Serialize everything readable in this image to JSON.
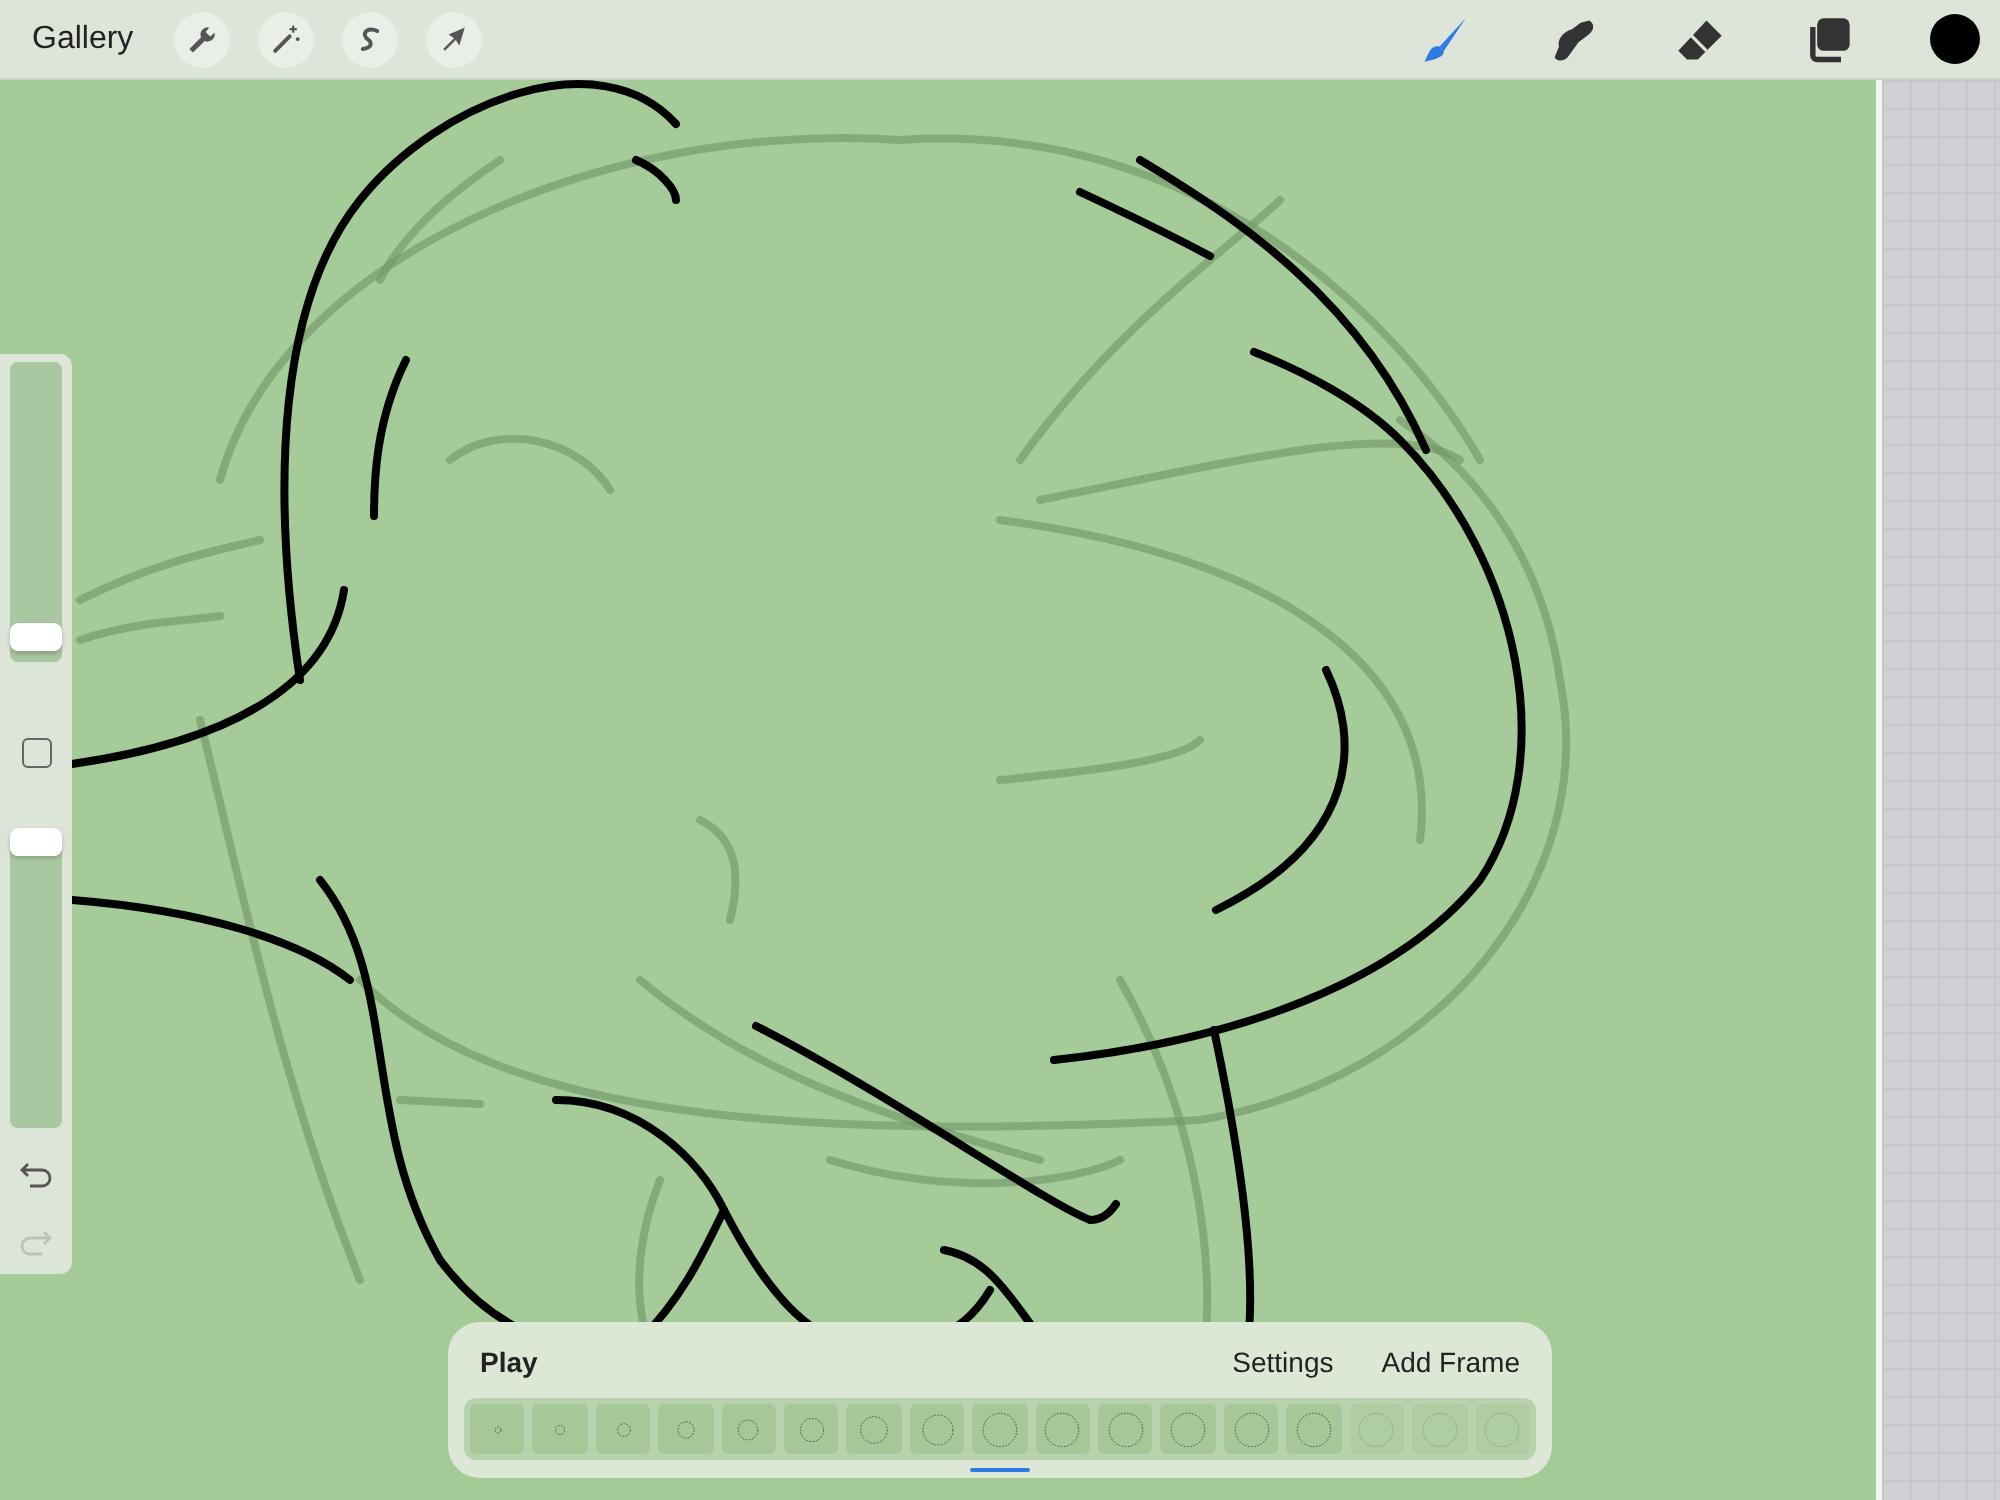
{
  "toolbar": {
    "gallery": "Gallery",
    "actions": [
      {
        "kind": "wrench"
      },
      {
        "kind": "wand"
      },
      {
        "kind": "selection"
      },
      {
        "kind": "transform"
      }
    ],
    "tools": [
      {
        "kind": "brush",
        "selected": true
      },
      {
        "kind": "smudge",
        "selected": false
      },
      {
        "kind": "eraser",
        "selected": false
      },
      {
        "kind": "layers",
        "selected": false
      }
    ],
    "color_swatch": {
      "color": "#000000"
    }
  },
  "sidebar": {
    "size_slider": {
      "level": 0.04
    },
    "opacity_slider": {
      "level": 1
    },
    "undo": {
      "disabled": false
    },
    "redo": {
      "disabled": true
    }
  },
  "animation_panel": {
    "play": "Play",
    "settings": "Settings",
    "add_frame": "Add Frame",
    "frames": [
      {
        "faded": false
      },
      {
        "faded": false
      },
      {
        "faded": false
      },
      {
        "faded": false
      },
      {
        "faded": false
      },
      {
        "faded": false
      },
      {
        "faded": false
      },
      {
        "faded": false
      },
      {
        "faded": false
      },
      {
        "faded": false
      },
      {
        "faded": false
      },
      {
        "faded": false
      },
      {
        "faded": false
      },
      {
        "faded": false
      },
      {
        "faded": true
      },
      {
        "faded": true
      },
      {
        "faded": true
      }
    ]
  }
}
